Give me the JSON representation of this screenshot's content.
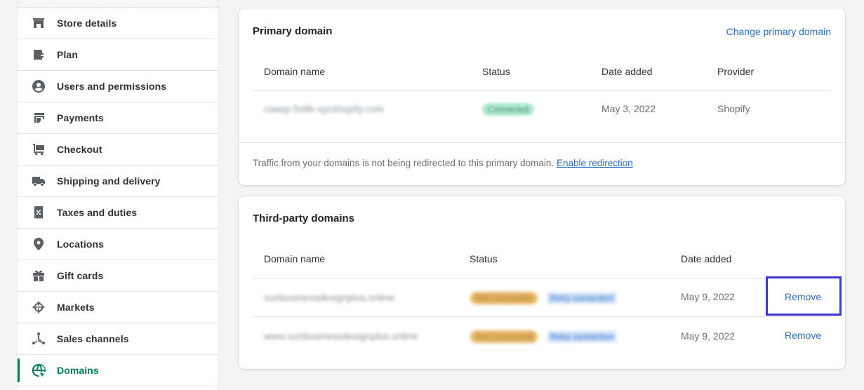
{
  "sidebar": {
    "items": [
      {
        "label": "Store details",
        "icon": "store-icon",
        "active": false
      },
      {
        "label": "Plan",
        "icon": "wallet-icon",
        "active": false
      },
      {
        "label": "Users and permissions",
        "icon": "user-icon",
        "active": false
      },
      {
        "label": "Payments",
        "icon": "payments-icon",
        "active": false
      },
      {
        "label": "Checkout",
        "icon": "cart-icon",
        "active": false
      },
      {
        "label": "Shipping and delivery",
        "icon": "truck-icon",
        "active": false
      },
      {
        "label": "Taxes and duties",
        "icon": "tax-receipt-icon",
        "active": false
      },
      {
        "label": "Locations",
        "icon": "location-pin-icon",
        "active": false
      },
      {
        "label": "Gift cards",
        "icon": "gift-icon",
        "active": false
      },
      {
        "label": "Markets",
        "icon": "globe-target-icon",
        "active": false
      },
      {
        "label": "Sales channels",
        "icon": "channels-icon",
        "active": false
      },
      {
        "label": "Domains",
        "icon": "domain-globe-icon",
        "active": true
      }
    ],
    "accent_color": "#008060"
  },
  "primary_domain": {
    "title": "Primary domain",
    "change_link": "Change primary domain",
    "columns": [
      "Domain name",
      "Status",
      "Date added",
      "Provider"
    ],
    "rows": [
      {
        "domain": "caasp-5x8k-xyzshopify.com",
        "status": "Connected",
        "date_added": "May 3, 2022",
        "provider": "Shopify"
      }
    ],
    "footer_text": "Traffic from your domains is not being redirected to this primary domain.",
    "footer_link": "Enable redirection"
  },
  "third_party_domains": {
    "title": "Third-party domains",
    "columns": [
      "Domain name",
      "Status",
      "Date added"
    ],
    "rows": [
      {
        "domain": "sunbusinessdesignplus.online",
        "status": "Not Connected",
        "retry": "Retry connection",
        "date_added": "May 9, 2022",
        "action": "Remove"
      },
      {
        "domain": "www.sunbusinessdesignplus.online",
        "status": "Not Connected",
        "retry": "Retry connection",
        "date_added": "May 9, 2022",
        "action": "Remove"
      }
    ]
  },
  "colors": {
    "link": "#2c6ecb",
    "highlight": "#3f37d8",
    "success_badge": "#aee9d1",
    "warning_badge": "#e8b766"
  }
}
